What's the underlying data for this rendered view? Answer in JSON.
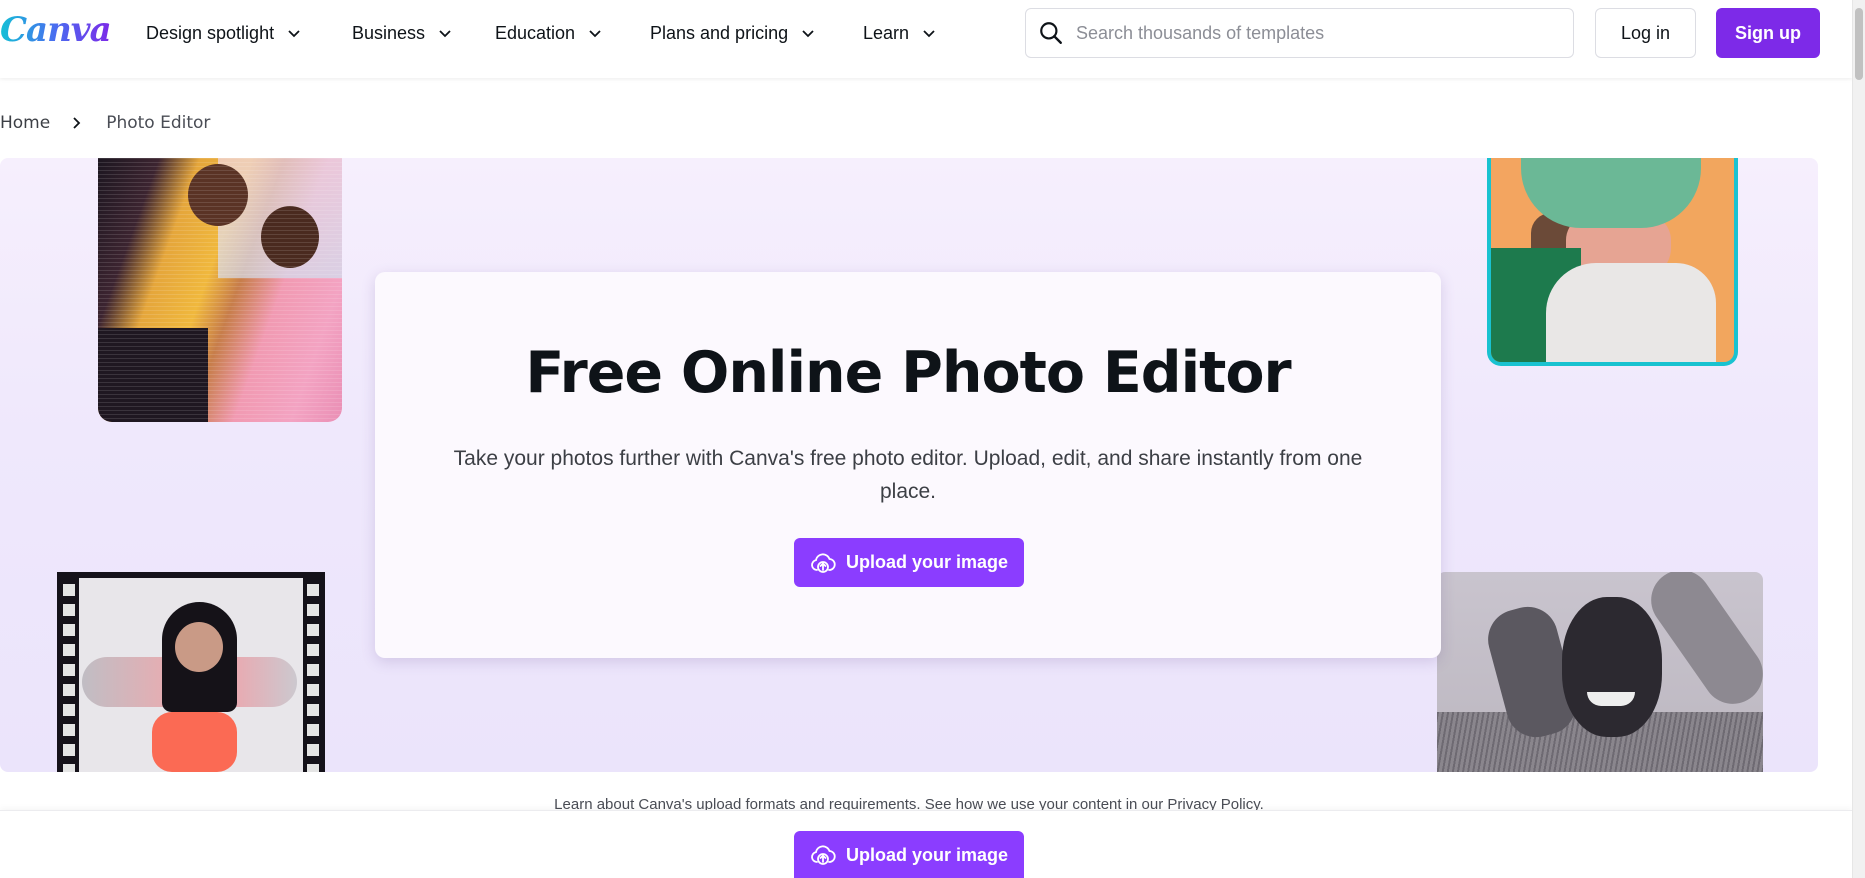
{
  "header": {
    "logo": "Canva",
    "nav": [
      {
        "label": "Design spotlight"
      },
      {
        "label": "Business"
      },
      {
        "label": "Education"
      },
      {
        "label": "Plans and pricing"
      },
      {
        "label": "Learn"
      }
    ],
    "search": {
      "placeholder": "Search thousands of templates",
      "value": ""
    },
    "login_label": "Log in",
    "signup_label": "Sign up"
  },
  "breadcrumb": {
    "home": "Home",
    "current": "Photo Editor"
  },
  "hero": {
    "title": "Free Online Photo Editor",
    "subtitle": "Take your photos further with Canva's free photo editor. Upload, edit, and share instantly from one place.",
    "upload_label": "Upload your image",
    "photos": [
      {
        "name": "two-men-dancing-photo",
        "icon": "image"
      },
      {
        "name": "woman-green-bucket-hat-photo",
        "icon": "image"
      },
      {
        "name": "woman-film-frame-photo",
        "icon": "image"
      },
      {
        "name": "man-smiling-comb-photo",
        "icon": "image"
      }
    ]
  },
  "footer_note": "Learn about Canva's upload formats and requirements. See how we use your content in our Privacy Policy.",
  "sticky_bar": {
    "upload_label": "Upload your image"
  },
  "colors": {
    "brand_purple": "#7d2ae8",
    "upload_purple": "#8b3dff",
    "hero_bg": "#efe8fc",
    "photo_border_teal": "#19c2d0"
  },
  "icons": {
    "search": "search-icon",
    "chevron": "chevron-down-icon",
    "breadcrumb_sep": "chevron-right-icon",
    "upload": "cloud-upload-icon"
  }
}
